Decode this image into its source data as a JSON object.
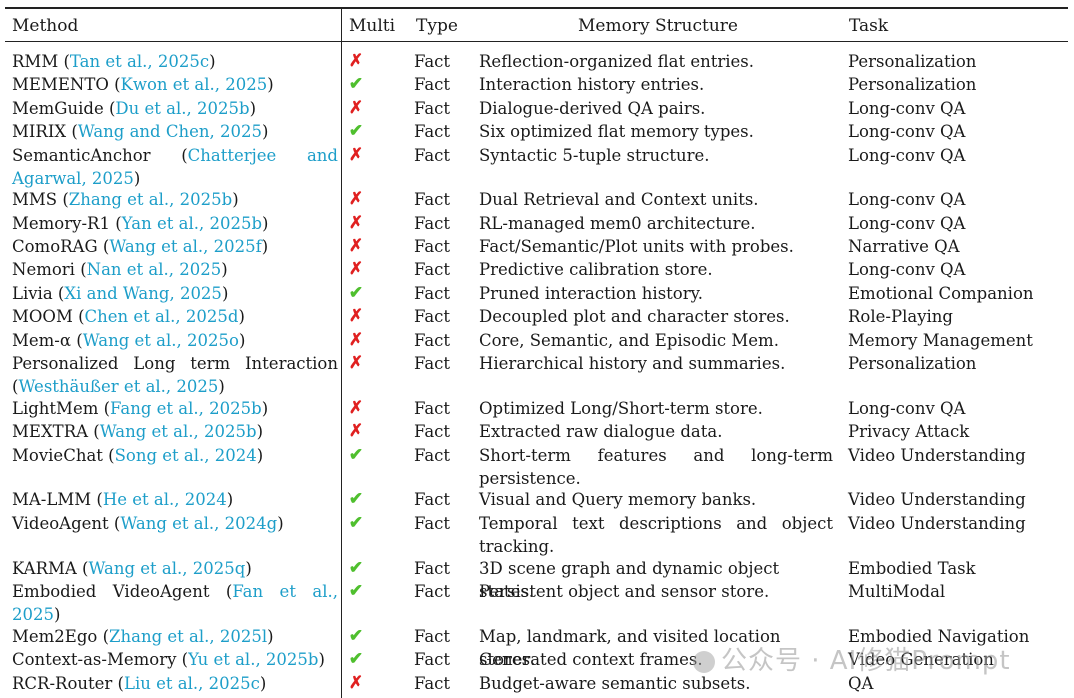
{
  "headers": {
    "method": "Method",
    "multi": "Multi",
    "type": "Type",
    "structure": "Memory Structure",
    "task": "Task"
  },
  "marks": {
    "yes": "✔",
    "no": "✗"
  },
  "colors": {
    "citation": "#1d9ec9",
    "check": "#4fbf2e",
    "cross": "#e02020"
  },
  "rows": [
    {
      "name": "RMM (",
      "cite": "Tan et al., 2025c",
      "close": ")",
      "multi": false,
      "type": "Fact",
      "structure": "Reflection-organized flat entries.",
      "task": "Personalization"
    },
    {
      "name": "MEMENTO (",
      "cite": "Kwon et al., 2025",
      "close": ")",
      "multi": true,
      "type": "Fact",
      "structure": "Interaction history entries.",
      "task": "Personalization"
    },
    {
      "name": "MemGuide (",
      "cite": "Du et al., 2025b",
      "close": ")",
      "multi": false,
      "type": "Fact",
      "structure": "Dialogue-derived QA pairs.",
      "task": "Long-conv QA"
    },
    {
      "name": "MIRIX (",
      "cite": "Wang and Chen, 2025",
      "close": ")",
      "multi": true,
      "type": "Fact",
      "structure": "Six optimized flat memory types.",
      "task": "Long-conv QA"
    },
    {
      "name": "SemanticAnchor (",
      "cite": "Chatterjee and Agarwal, 2025",
      "close": ")",
      "multi": false,
      "type": "Fact",
      "structure": "Syntactic 5-tuple structure.",
      "task": "Long-conv QA"
    },
    {
      "name": "MMS (",
      "cite": "Zhang et al., 2025b",
      "close": ")",
      "multi": false,
      "type": "Fact",
      "structure": "Dual Retrieval and Context units.",
      "task": "Long-conv QA"
    },
    {
      "name": "Memory-R1 (",
      "cite": "Yan et al., 2025b",
      "close": ")",
      "multi": false,
      "type": "Fact",
      "structure": "RL-managed mem0 architecture.",
      "task": "Long-conv QA"
    },
    {
      "name": "ComoRAG (",
      "cite": "Wang et al., 2025f",
      "close": ")",
      "multi": false,
      "type": "Fact",
      "structure": "Fact/Semantic/Plot units with probes.",
      "task": "Narrative QA"
    },
    {
      "name": "Nemori (",
      "cite": "Nan et al., 2025",
      "close": ")",
      "multi": false,
      "type": "Fact",
      "structure": "Predictive calibration store.",
      "task": "Long-conv QA"
    },
    {
      "name": "Livia (",
      "cite": "Xi and Wang, 2025",
      "close": ")",
      "multi": true,
      "type": "Fact",
      "structure": "Pruned interaction history.",
      "task": "Emotional Companion"
    },
    {
      "name": "MOOM (",
      "cite": "Chen et al., 2025d",
      "close": ")",
      "multi": false,
      "type": "Fact",
      "structure": "Decoupled plot and character stores.",
      "task": "Role-Playing"
    },
    {
      "name": "Mem-α (",
      "cite": "Wang et al., 2025o",
      "close": ")",
      "multi": false,
      "type": "Fact",
      "structure": "Core, Semantic, and Episodic Mem.",
      "task": "Memory Management"
    },
    {
      "name": "Personalized Long term Interaction (",
      "cite": "Westhäußer et al., 2025",
      "close": ")",
      "multi": false,
      "type": "Fact",
      "structure": "Hierarchical history and summaries.",
      "task": "Personalization"
    },
    {
      "name": "LightMem (",
      "cite": "Fang et al., 2025b",
      "close": ")",
      "multi": false,
      "type": "Fact",
      "structure": "Optimized Long/Short-term store.",
      "task": "Long-conv QA"
    },
    {
      "name": "MEXTRA (",
      "cite": "Wang et al., 2025b",
      "close": ")",
      "multi": false,
      "type": "Fact",
      "structure": "Extracted raw dialogue data.",
      "task": "Privacy Attack"
    },
    {
      "name": "MovieChat (",
      "cite": "Song et al., 2024",
      "close": ")",
      "multi": true,
      "type": "Fact",
      "structure": "Short-term features and long-term persistence.",
      "task": "Video Understanding"
    },
    {
      "name": "MA-LMM (",
      "cite": "He et al., 2024",
      "close": ")",
      "multi": true,
      "type": "Fact",
      "structure": "Visual and Query memory banks.",
      "task": "Video Understanding"
    },
    {
      "name": "VideoAgent (",
      "cite": "Wang et al., 2024g",
      "close": ")",
      "multi": true,
      "type": "Fact",
      "structure": "Temporal text descriptions and object tracking.",
      "task": "Video Understanding"
    },
    {
      "name": "KARMA (",
      "cite": "Wang et al., 2025q",
      "close": ")",
      "multi": true,
      "type": "Fact",
      "structure": "3D scene graph and dynamic object states.",
      "task": "Embodied Task"
    },
    {
      "name": "Embodied VideoAgent (",
      "cite": "Fan et al., 2025",
      "close": ")",
      "multi": true,
      "type": "Fact",
      "structure": "Persistent object and sensor store.",
      "task": "MultiModal"
    },
    {
      "name": "Mem2Ego (",
      "cite": "Zhang et al., 2025l",
      "close": ")",
      "multi": true,
      "type": "Fact",
      "structure": "Map, landmark, and visited location stores.",
      "task": "Embodied Navigation"
    },
    {
      "name": "Context-as-Memory (",
      "cite": "Yu et al., 2025b",
      "close": ")",
      "multi": true,
      "type": "Fact",
      "structure": "Generated context frames.",
      "task": "Video Generation"
    },
    {
      "name": "RCR-Router (",
      "cite": "Liu et al., 2025c",
      "close": ")",
      "multi": false,
      "type": "Fact",
      "structure": "Budget-aware semantic subsets.",
      "task": "QA"
    }
  ],
  "watermark": {
    "text": "公众号 · AI修猫Prompt",
    "icon": "wechat-icon"
  }
}
